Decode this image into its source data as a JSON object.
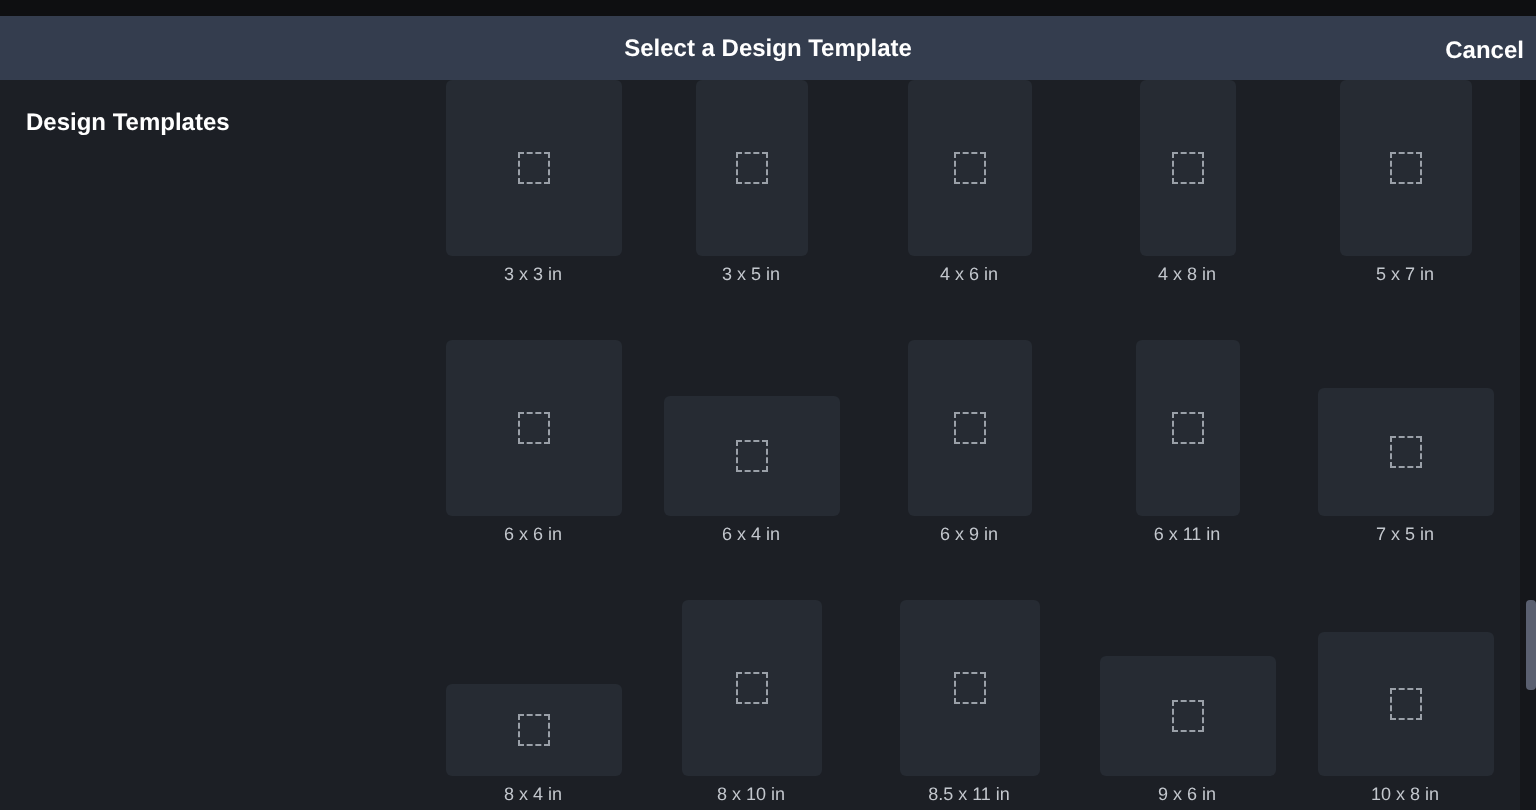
{
  "header": {
    "title": "Select a Design Template",
    "cancel": "Cancel"
  },
  "sidebar": {
    "title": "Design Templates"
  },
  "templates": [
    {
      "label": "3 x 3 in"
    },
    {
      "label": "3 x 5 in"
    },
    {
      "label": "4 x 6 in"
    },
    {
      "label": "4 x 8 in"
    },
    {
      "label": "5 x 7 in"
    },
    {
      "label": "6 x 6 in"
    },
    {
      "label": "6 x 4 in"
    },
    {
      "label": "6 x 9 in"
    },
    {
      "label": "6 x 11 in"
    },
    {
      "label": "7 x 5 in"
    },
    {
      "label": "8 x 4 in"
    },
    {
      "label": "8 x 10 in"
    },
    {
      "label": "8.5 x 11 in"
    },
    {
      "label": "9 x 6 in"
    },
    {
      "label": "10 x 8 in"
    }
  ]
}
